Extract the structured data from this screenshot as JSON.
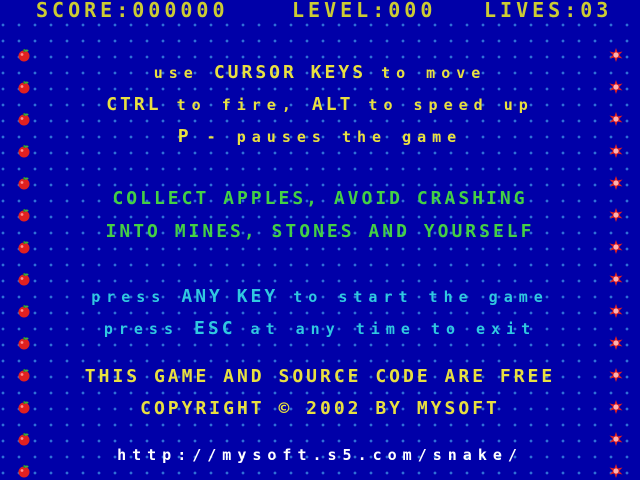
{
  "hud": {
    "score": "SCORE:000000",
    "level": "LEVEL:000",
    "lives": "LIVES:03"
  },
  "instructions": {
    "line1": {
      "pre": "use ",
      "key": "CURSOR KEYS",
      "post": " to move"
    },
    "line2": {
      "key1": "CTRL",
      "mid": " to fire, ",
      "key2": "ALT",
      "post": " to speed up"
    },
    "line3": {
      "key": "P",
      "post": " - pauses the game"
    }
  },
  "goal": {
    "line1": "COLLECT APPLES, AVOID CRASHING",
    "line2": "INTO MINES, STONES AND YOURSELF"
  },
  "start": {
    "line1": {
      "pre": "press ",
      "key": "ANY KEY",
      "post": " to start the game"
    },
    "line2": {
      "pre": "press ",
      "key": "ESC",
      "post": " at any time to exit"
    }
  },
  "credits": {
    "line1": "THIS GAME AND SOURCE CODE ARE FREE",
    "line2": "COPYRIGHT © 2002 BY MYSOFT",
    "url": "http://mysoft.s5.com/snake/"
  },
  "colors": {
    "background": "#0000a8",
    "dot_grid": "#2f6fd6",
    "hud_text": "#cccc33",
    "highlight": "#e8e040",
    "goal_text": "#44d044",
    "start_text": "#30c8e0",
    "apple": "#e02020",
    "mine": "#e02020"
  },
  "icons": {
    "left_column": "apple-icon",
    "right_column": "mine-icon"
  }
}
